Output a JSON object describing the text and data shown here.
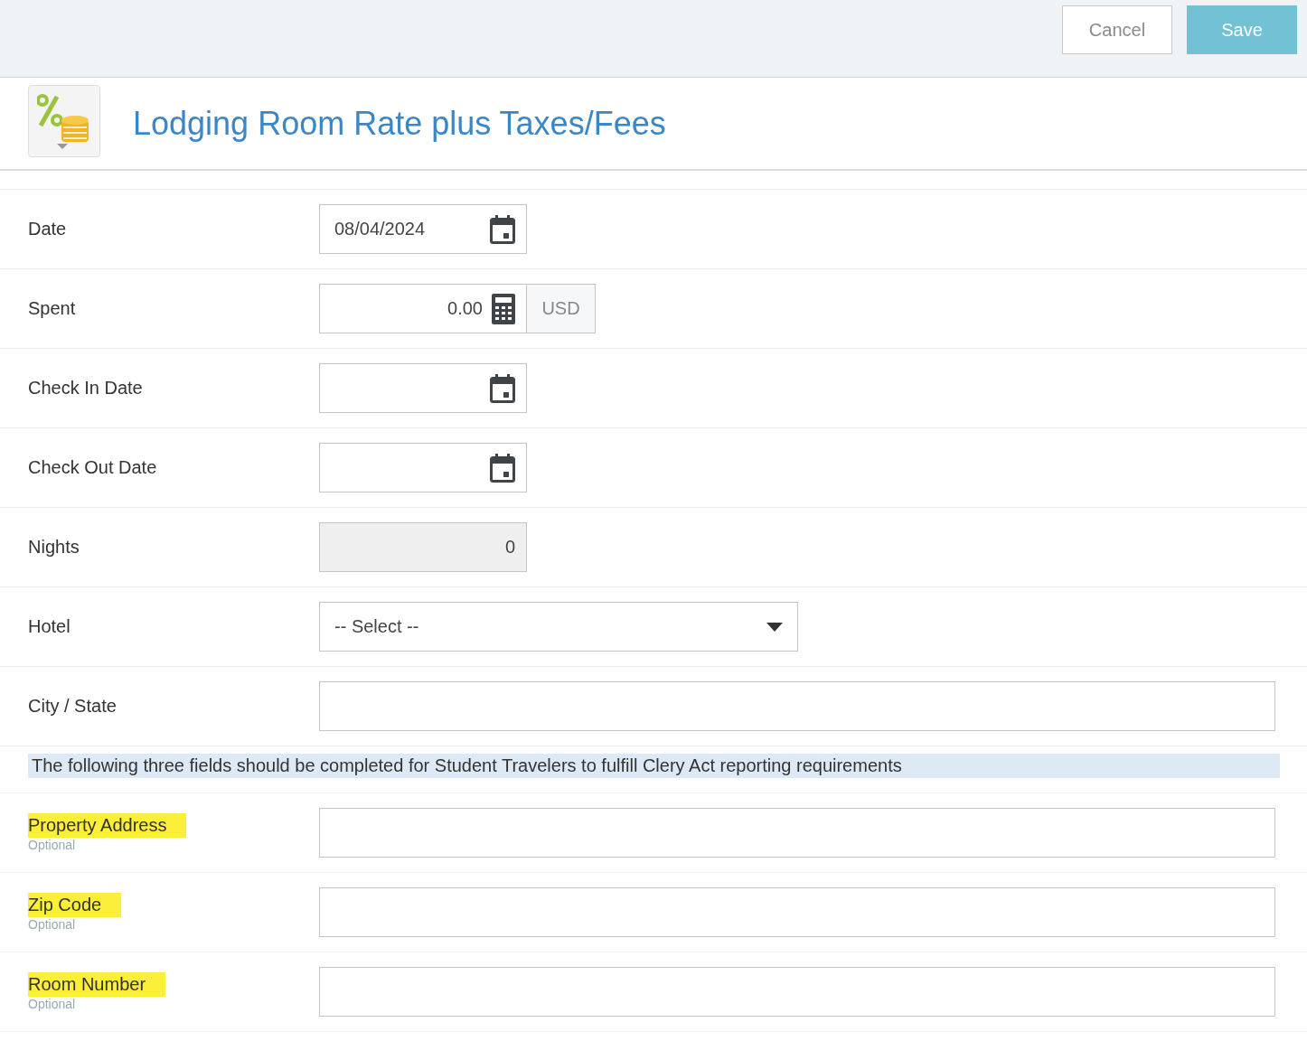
{
  "toolbar": {
    "buttons": [
      {
        "label": "Cancel",
        "kind": "secondary"
      },
      {
        "label": "Save",
        "kind": "primary"
      }
    ]
  },
  "header": {
    "title": "Lodging Room Rate plus Taxes/Fees"
  },
  "form": {
    "rows": [
      {
        "kind": "date",
        "label": "Date",
        "value": "08/04/2024"
      },
      {
        "kind": "amount",
        "label": "Spent",
        "value": "0.00",
        "currency": "USD"
      },
      {
        "kind": "date",
        "label": "Check In Date"
      },
      {
        "kind": "date",
        "label": "Check Out Date"
      },
      {
        "kind": "number",
        "label": "Nights",
        "value": "0",
        "disabled": true
      },
      {
        "kind": "select",
        "label": "Hotel",
        "value": "-- Select --"
      },
      {
        "kind": "text",
        "label": "City / State",
        "highlighted": false
      },
      {
        "kind": "note",
        "text": "The following three fields should be completed for Student Travelers to fulfill Clery Act reporting requirements"
      },
      {
        "kind": "text",
        "label": "Property Address",
        "hint": "Optional",
        "highlighted": true
      },
      {
        "kind": "text",
        "label": "Zip Code",
        "hint": "Optional",
        "highlighted": true
      },
      {
        "kind": "text",
        "label": "Room Number",
        "hint": "Optional",
        "highlighted": true
      }
    ]
  }
}
